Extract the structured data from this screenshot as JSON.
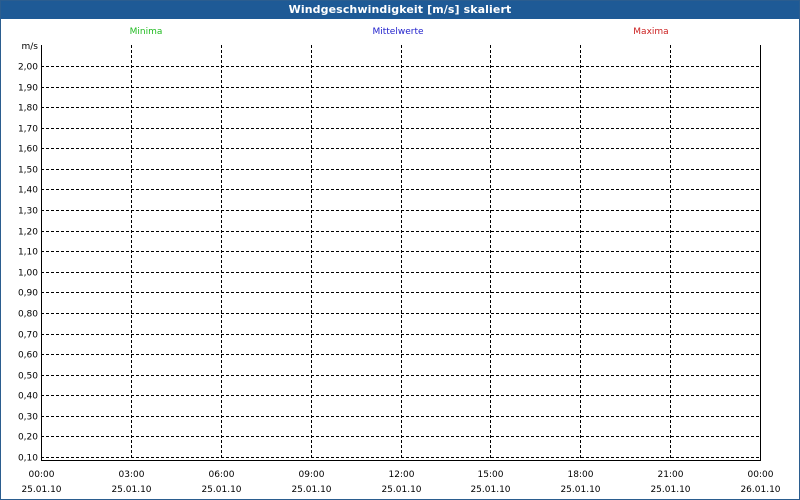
{
  "window": {
    "title": "Windgeschwindigkeit [m/s] skaliert"
  },
  "chart_data": {
    "type": "line",
    "title": "Windgeschwindigkeit [m/s] skaliert",
    "ylabel": "m/s",
    "xlabel": "",
    "ylim": [
      0.09,
      2.1
    ],
    "y_ticks": [
      "2,00",
      "1,90",
      "1,80",
      "1,70",
      "1,60",
      "1,50",
      "1,40",
      "1,30",
      "1,20",
      "1,10",
      "1,00",
      "0,90",
      "0,80",
      "0,70",
      "0,60",
      "0,50",
      "0,40",
      "0,30",
      "0,20",
      "0,10"
    ],
    "y_tick_values": [
      2.0,
      1.9,
      1.8,
      1.7,
      1.6,
      1.5,
      1.4,
      1.3,
      1.2,
      1.1,
      1.0,
      0.9,
      0.8,
      0.7,
      0.6,
      0.5,
      0.4,
      0.3,
      0.2,
      0.1
    ],
    "x_ticks": [
      {
        "time": "00:00",
        "date": "25.01.10"
      },
      {
        "time": "03:00",
        "date": "25.01.10"
      },
      {
        "time": "06:00",
        "date": "25.01.10"
      },
      {
        "time": "09:00",
        "date": "25.01.10"
      },
      {
        "time": "12:00",
        "date": "25.01.10"
      },
      {
        "time": "15:00",
        "date": "25.01.10"
      },
      {
        "time": "18:00",
        "date": "25.01.10"
      },
      {
        "time": "21:00",
        "date": "25.01.10"
      },
      {
        "time": "00:00",
        "date": "26.01.10"
      }
    ],
    "grid": true,
    "legend_position": "top",
    "series": [
      {
        "name": "Minima",
        "color": "#22bb22",
        "values": []
      },
      {
        "name": "Mittelwerte",
        "color": "#2222cc",
        "values": []
      },
      {
        "name": "Maxima",
        "color": "#cc2222",
        "values": []
      }
    ]
  }
}
